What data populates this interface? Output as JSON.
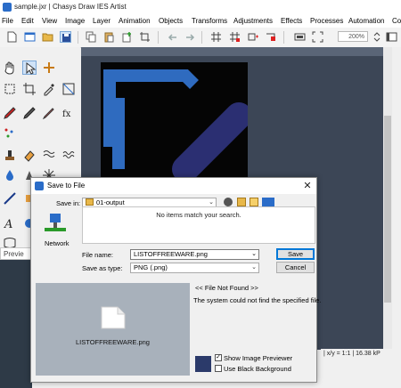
{
  "window": {
    "title": "sample.jxr | Chasys Draw IES Artist"
  },
  "menu": [
    "File",
    "Edit",
    "View",
    "Image",
    "Layer",
    "Animation",
    "Objects",
    "Transforms",
    "Adjustments",
    "Effects",
    "Processes",
    "Automation",
    "Co"
  ],
  "toolbar": {
    "zoom": "200%"
  },
  "preview_tab": "Previe",
  "status": "| x/y = 1:1 | 16.38 kP",
  "dialog": {
    "title": "Save to File",
    "save_in_label": "Save in:",
    "save_in_value": "01-output",
    "empty_message": "No items match your search.",
    "network_label": "Network",
    "file_name_label": "File name:",
    "file_name_value": "LISTOFFREEWARE.png",
    "save_as_type_label": "Save as type:",
    "save_as_type_value": "PNG (.png)",
    "save_button": "Save",
    "cancel_button": "Cancel",
    "preview_filename": "LISTOFFREEWARE.png",
    "file_status": "<< File Not Found >>",
    "file_message": "The system could not find the specified file.",
    "show_previewer_label": "Show Image Previewer",
    "show_previewer_checked": true,
    "black_background_label": "Use Black Background",
    "black_background_checked": false
  },
  "colors": {
    "canvas_bg": "#050505",
    "logo_blue": "#2f6bbf",
    "logo_navy": "#2b2f72",
    "workspace": "#3c4656"
  }
}
